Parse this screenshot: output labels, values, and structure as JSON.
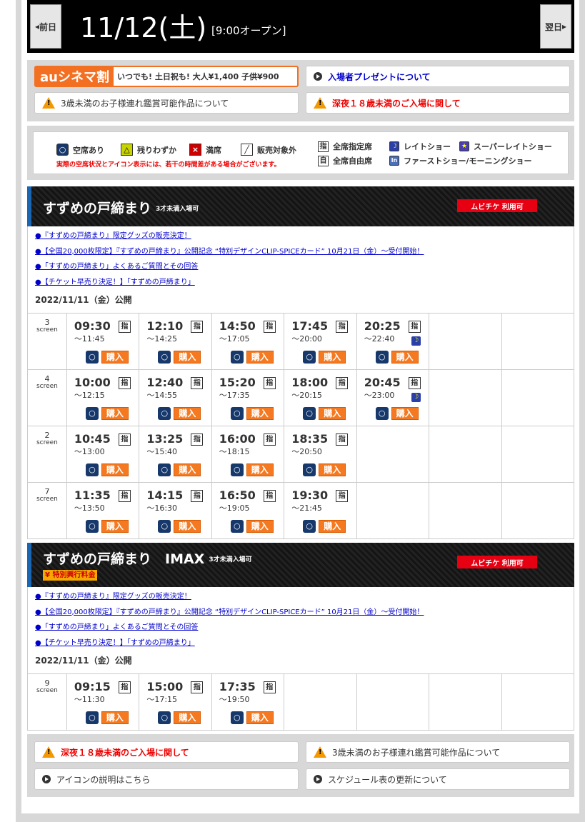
{
  "header": {
    "prev": "前日",
    "next": "翌日",
    "date": "11/12(土)",
    "open": "[9:00オープン]"
  },
  "info": {
    "au_logo": "auシネマ割",
    "au_text": "いつでも! 土日祝も! 大人¥1,400 子供¥900",
    "present": "入場者プレゼントについて",
    "under3": "3歳未満のお子様連れ鑑賞可能作品について",
    "late18": "深夜１８歳未満のご入場に関して"
  },
  "legend": {
    "vacant": "空席あり",
    "few": "残りわずか",
    "full": "満席",
    "na": "販売対象外",
    "reserved": "全席指定席",
    "free": "全席自由席",
    "late": "レイトショー",
    "superlate": "スーパーレイトショー",
    "first": "ファーストショー/モーニングショー",
    "note": "実際の空席状況とアイコン表示には、若干の時間差がある場合がございます。",
    "ico_o": "○",
    "ico_tri": "△",
    "ico_x": "×",
    "ico_sh": "指",
    "ico_ji": "自"
  },
  "movies": [
    {
      "title": "すずめの戸締まり",
      "age": "3才未満入場可",
      "mubi": "ムビチケ 利用可",
      "links": [
        "●『すずめの戸締まり』限定グッズの販売決定！",
        "●【全国20,000枚限定】『すずめの戸締まり』公開記念 “特別デザインCLIP-SPICEカード” 10月21日（金）～受付開始！",
        "●「すずめの戸締まり」よくあるご質問とその回答",
        "●【チケット早売り決定！】「すずめの戸締まり」"
      ],
      "release": "2022/11/11（金）公開"
    },
    {
      "title": "すずめの戸締まり　IMAX",
      "age": "3才未満入場可",
      "mubi": "ムビチケ 利用可",
      "special": "¥ 特別興行料金",
      "links": [
        "●『すずめの戸締まり』限定グッズの販売決定！",
        "●【全国20,000枚限定】『すずめの戸締まり』公開記念 “特別デザインCLIP-SPICEカード” 10月21日（金）～受付開始！",
        "●「すずめの戸締まり」よくあるご質問とその回答",
        "●【チケット早売り決定！】「すずめの戸締まり」"
      ],
      "release": "2022/11/11（金）公開"
    }
  ],
  "schedule": [
    {
      "screen": "3",
      "sessions": [
        [
          "09:30",
          "～11:45",
          false
        ],
        [
          "12:10",
          "～14:25",
          false
        ],
        [
          "14:50",
          "～17:05",
          false
        ],
        [
          "17:45",
          "～20:00",
          false
        ],
        [
          "20:25",
          "～22:40",
          true
        ]
      ]
    },
    {
      "screen": "4",
      "sessions": [
        [
          "10:00",
          "～12:15",
          false
        ],
        [
          "12:40",
          "～14:55",
          false
        ],
        [
          "15:20",
          "～17:35",
          false
        ],
        [
          "18:00",
          "～20:15",
          false
        ],
        [
          "20:45",
          "～23:00",
          true
        ]
      ]
    },
    {
      "screen": "2",
      "sessions": [
        [
          "10:45",
          "～13:00",
          false
        ],
        [
          "13:25",
          "～15:40",
          false
        ],
        [
          "16:00",
          "～18:15",
          false
        ],
        [
          "18:35",
          "～20:50",
          false
        ]
      ]
    },
    {
      "screen": "7",
      "sessions": [
        [
          "11:35",
          "～13:50",
          false
        ],
        [
          "14:15",
          "～16:30",
          false
        ],
        [
          "16:50",
          "～19:05",
          false
        ],
        [
          "19:30",
          "～21:45",
          false
        ]
      ]
    }
  ],
  "schedule_imax": [
    {
      "screen": "9",
      "sessions": [
        [
          "09:15",
          "～11:30",
          false
        ],
        [
          "15:00",
          "～17:15",
          false
        ],
        [
          "17:35",
          "～19:50",
          false
        ]
      ]
    }
  ],
  "cell": {
    "screen_word": "screen",
    "shitei": "指",
    "buy": "購入",
    "vacant": "○",
    "moon": "☽"
  },
  "footer": {
    "late18": "深夜１８歳未満のご入場に関して",
    "under3": "3歳未満のお子様連れ鑑賞可能作品について",
    "icons": "アイコンの説明はこちら",
    "update": "スケジュール表の更新について"
  }
}
